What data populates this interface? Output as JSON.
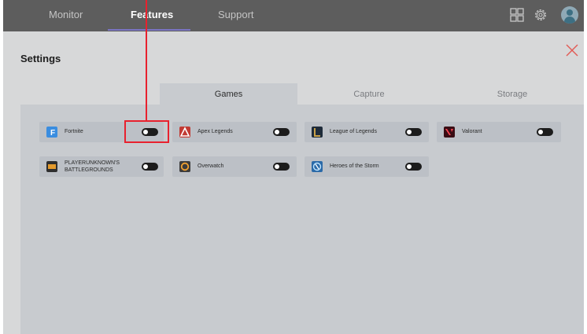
{
  "topbar": {
    "tabs": [
      {
        "label": "Monitor"
      },
      {
        "label": "Features"
      },
      {
        "label": "Support"
      }
    ],
    "active_tab": "Features",
    "icons": [
      "grid-icon",
      "gear-icon",
      "avatar"
    ]
  },
  "settings": {
    "title": "Settings",
    "subtabs": [
      {
        "label": "Games"
      },
      {
        "label": "Capture"
      },
      {
        "label": "Storage"
      }
    ],
    "active_subtab": "Games",
    "games": [
      {
        "name": "Fortnite",
        "enabled": false,
        "icon_color": "#3a8de0"
      },
      {
        "name": "Apex Legends",
        "enabled": false,
        "icon_color": "#c23a33"
      },
      {
        "name": "League of Legends",
        "enabled": false,
        "icon_color": "#1e2b3a"
      },
      {
        "name": "Valorant",
        "enabled": false,
        "icon_color": "#e84a5c"
      },
      {
        "name": "PLAYERUNKNOWN'S BATTLEGROUNDS",
        "name_line1": "PLAYERUNKNOWN'S",
        "name_line2": "BATTLEGROUNDS",
        "enabled": false,
        "icon_color": "#e39a2c"
      },
      {
        "name": "Overwatch",
        "enabled": false,
        "icon_color": "#3c3c3c"
      },
      {
        "name": "Heroes of the Storm",
        "enabled": false,
        "icon_color": "#2b6aa8"
      }
    ]
  },
  "colors": {
    "topbar": "#5d5d5d",
    "content_bg": "#d7d8d9",
    "panel_bg": "#c8cbcf",
    "card_bg": "#bcc0c6",
    "highlight": "#e8212e",
    "tab_underline": "#7a74c4"
  }
}
